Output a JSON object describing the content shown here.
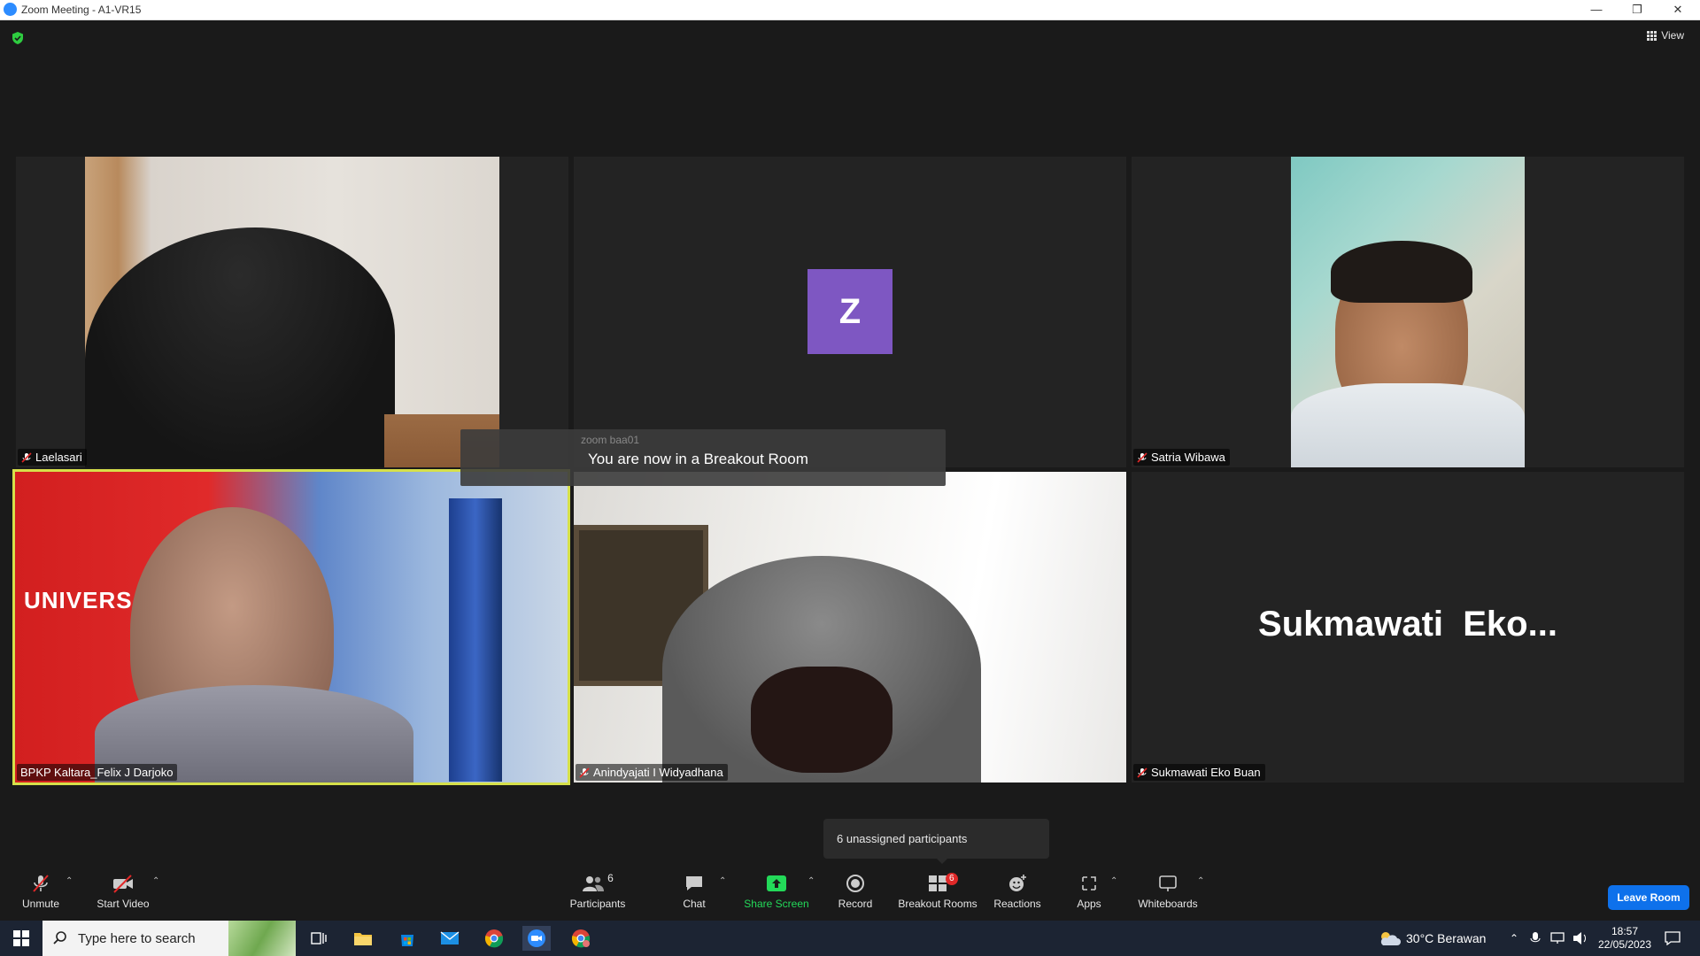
{
  "window": {
    "title": "Zoom Meeting - A1-VR15"
  },
  "top": {
    "view_label": "View"
  },
  "tiles": [
    {
      "name": "Laelasari"
    },
    {
      "name": "zoom baa01",
      "avatar_letter": "Z"
    },
    {
      "name": "Satria Wibawa"
    },
    {
      "name": "BPKP Kaltara_Felix J Darjoko"
    },
    {
      "name": "Anindyajati I Widyadhana"
    },
    {
      "name": "Sukmawati Eko Buan",
      "display_text": "Sukmawati  Eko..."
    }
  ],
  "toast": {
    "message": "You are now in a Breakout Room"
  },
  "unassigned": {
    "text": "6 unassigned participants"
  },
  "toolbar": {
    "unmute": "Unmute",
    "start_video": "Start Video",
    "participants": "Participants",
    "participants_count": "6",
    "chat": "Chat",
    "share_screen": "Share Screen",
    "record": "Record",
    "breakout_rooms": "Breakout Rooms",
    "breakout_badge": "6",
    "reactions": "Reactions",
    "apps": "Apps",
    "whiteboards": "Whiteboards",
    "leave": "Leave Room"
  },
  "taskbar": {
    "search_placeholder": "Type here to search",
    "weather": "30°C  Berawan",
    "time": "18:57",
    "date": "22/05/2023"
  },
  "colors": {
    "accent": "#0e71eb",
    "share": "#23d959",
    "avatar": "#7e57c2",
    "speaker_border": "#d6e04a",
    "badge": "#e02828"
  }
}
